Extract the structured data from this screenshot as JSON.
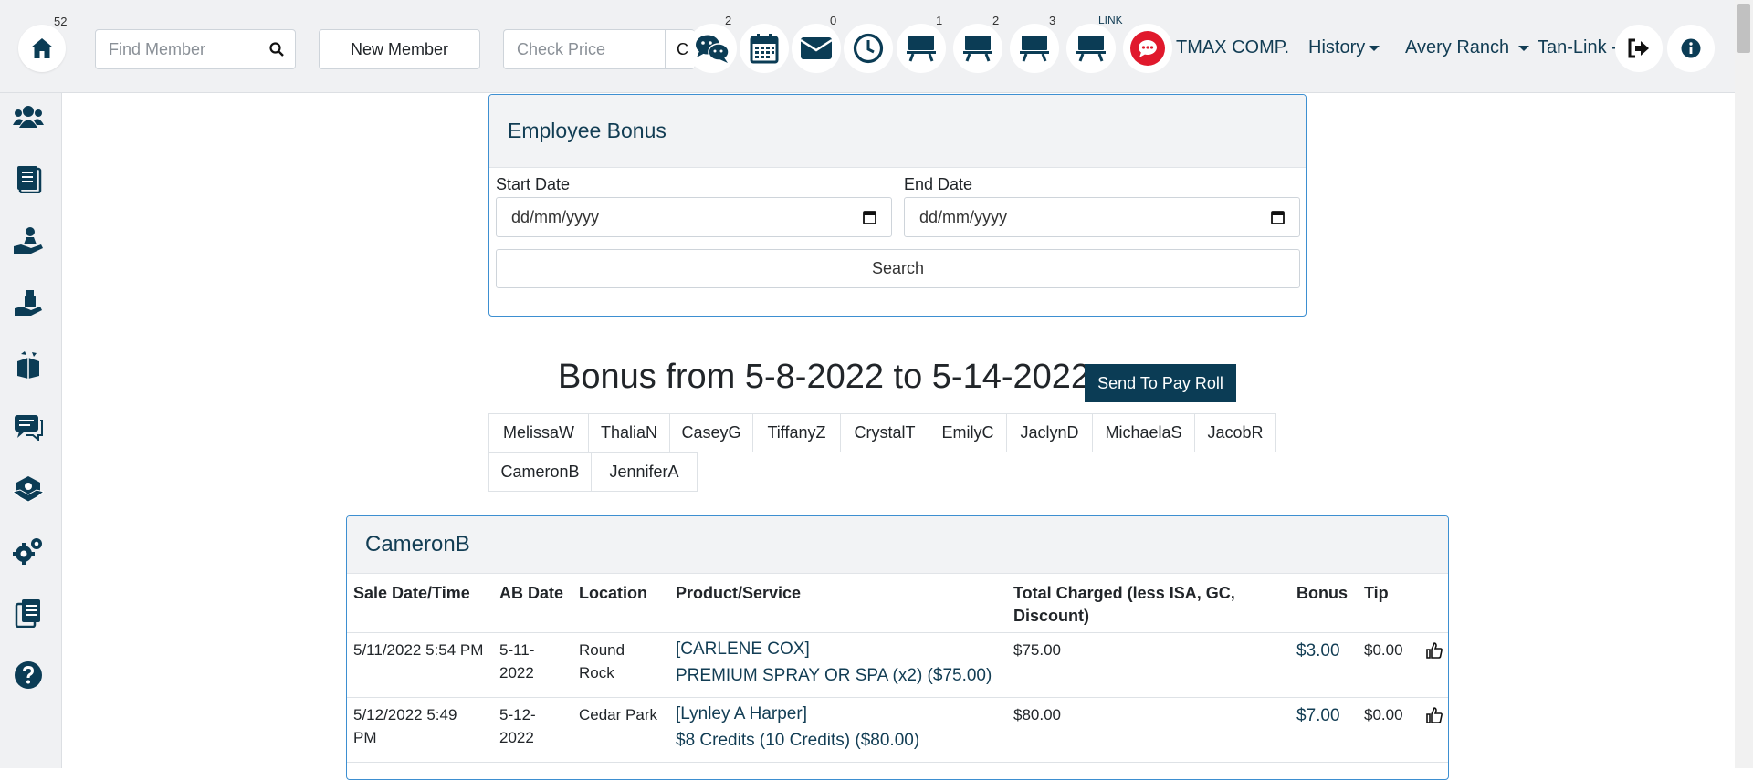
{
  "topbar": {
    "home_badge": "52",
    "find_member_placeholder": "Find Member",
    "new_member_label": "New Member",
    "check_price_placeholder": "Check Price",
    "check_price_overflow": "C",
    "chat_badge": "2",
    "mail_badge": "0",
    "bed1_badge": "1",
    "bed2_badge": "2",
    "bed3_badge": "3",
    "bed4_badge": "LINK",
    "company": "TMAX COMP.",
    "history_label": "History",
    "location_label": "Avery Ranch",
    "tanlink_label": "Tan-Link -",
    "accent_color": "#0b3c55",
    "alert_color": "#e0192c"
  },
  "sidebar": {
    "items": [
      "members-icon",
      "notes-icon",
      "service-icon",
      "spray-icon",
      "inventory-icon",
      "messages-icon",
      "packages-icon",
      "settings-icon",
      "reports-icon",
      "help-icon"
    ]
  },
  "form": {
    "title": "Employee Bonus",
    "start_label": "Start Date",
    "start_placeholder": "dd/mm/yyyy",
    "end_label": "End Date",
    "end_placeholder": "dd/mm/yyyy",
    "search_label": "Search"
  },
  "heading": {
    "title": "Bonus from 5-8-2022 to 5-14-2022",
    "payroll_button": "Send To Pay Roll"
  },
  "employees": [
    "MelissaW",
    "ThaliaN",
    "CaseyG",
    "TiffanyZ",
    "CrystalT",
    "EmilyC",
    "JaclynD",
    "MichaelaS",
    "JacobR",
    "CameronB",
    "JenniferA"
  ],
  "results": {
    "employee": "CameronB",
    "columns": [
      "Sale Date/Time",
      "AB Date",
      "Location",
      "Product/Service",
      "Total Charged (less ISA, GC, Discount)",
      "Bonus",
      "Tip"
    ],
    "rows": [
      {
        "sale_date": "5/11/2022 5:54 PM",
        "ab_date": "5-11-2022",
        "location": "Round Rock",
        "customer": "[CARLENE COX]",
        "product": "PREMIUM SPRAY OR SPA (x2) ($75.00)",
        "total": "$75.00",
        "bonus": "$3.00",
        "tip": "$0.00"
      },
      {
        "sale_date": "5/12/2022 5:49 PM",
        "ab_date": "5-12-2022",
        "location": "Cedar Park",
        "customer": "[Lynley A Harper]",
        "product": "$8 Credits (10 Credits) ($80.00)",
        "total": "$80.00",
        "bonus": "$7.00",
        "tip": "$0.00"
      }
    ]
  }
}
